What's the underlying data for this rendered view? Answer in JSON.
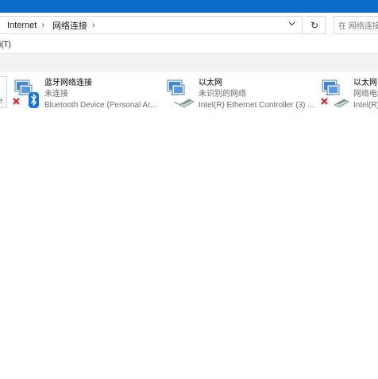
{
  "address_bar": {
    "crumbs": [
      "Internet",
      "网络连接"
    ],
    "separator": "›",
    "dropdown_icon": "chevron-down-icon",
    "refresh_icon": "refresh-icon",
    "refresh_glyph": "↻"
  },
  "search": {
    "placeholder": "在 网络连接"
  },
  "menu": {
    "item": "i(T)"
  },
  "left_stub": {
    "text": "e"
  },
  "adapters": [
    {
      "name": "蓝牙网络连接",
      "status": "未连接",
      "device": "Bluetooth Device (Personal Ar...",
      "icon": "bluetooth-network-icon",
      "disconnected": true
    },
    {
      "name": "以太网",
      "status": "未识别的网络",
      "device": "Intel(R) Ethernet Controller (3) ...",
      "icon": "ethernet-network-icon",
      "disconnected": false
    },
    {
      "name": "以太网",
      "status": "网络电缆",
      "device": "Intel(R)",
      "icon": "ethernet-network-icon",
      "disconnected": true
    }
  ],
  "colors": {
    "titlebar": "#0b6cc9",
    "status_text": "#6d6d6d",
    "disconnect_x": "#d6232a",
    "bluetooth": "#1a73d9"
  }
}
